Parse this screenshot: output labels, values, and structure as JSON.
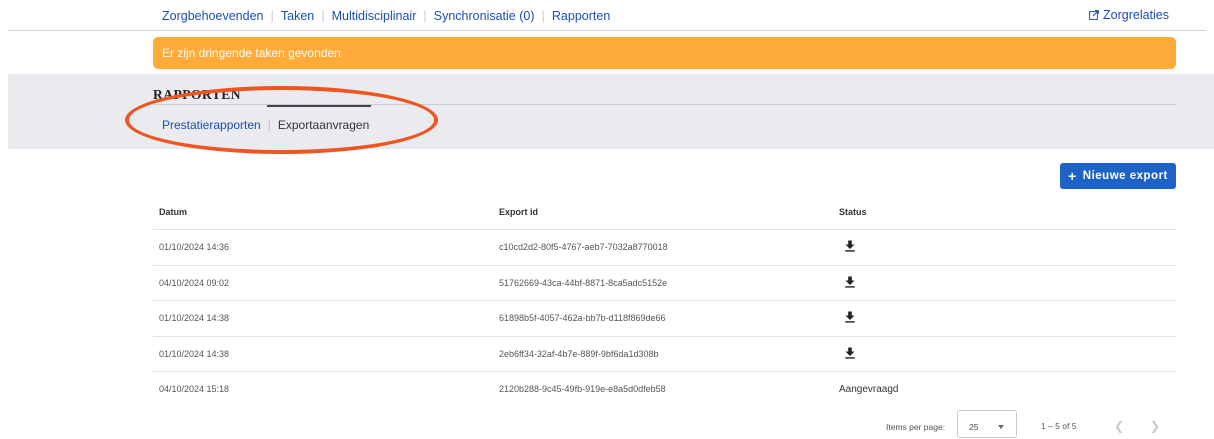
{
  "topnav": {
    "items": [
      {
        "label": "Zorgbehoevenden"
      },
      {
        "label": "Taken"
      },
      {
        "label": "Multidisciplinair"
      },
      {
        "label": "Synchronisatie (0)"
      },
      {
        "label": "Rapporten"
      }
    ],
    "right_link": "Zorgrelaties"
  },
  "alert": {
    "text": "Er zijn dringende taken gevonden",
    "color": "#ffab3a"
  },
  "section": {
    "title": "RAPPORTEN",
    "tabs": [
      {
        "label": "Prestatierapporten",
        "active": false
      },
      {
        "label": "Exportaanvragen",
        "active": true
      }
    ]
  },
  "new_export_button": {
    "label": "Nieuwe export",
    "icon": "plus-icon",
    "color": "#1f62c7"
  },
  "table": {
    "columns": [
      "Datum",
      "Export id",
      "Status"
    ],
    "rows": [
      {
        "datum": "01/10/2024 14:36",
        "export_id": "c10cd2d2-80f5-4767-aeb7-7032a8770018",
        "status": "download-icon"
      },
      {
        "datum": "04/10/2024 09:02",
        "export_id": "51762669-43ca-44bf-8871-8ca5adc5152e",
        "status": "download-icon"
      },
      {
        "datum": "01/10/2024 14:38",
        "export_id": "61898b5f-4057-462a-bb7b-d118f869de66",
        "status": "download-icon"
      },
      {
        "datum": "01/10/2024 14:38",
        "export_id": "2eb6ff34-32af-4b7e-889f-9bf6da1d308b",
        "status": "download-icon"
      },
      {
        "datum": "04/10/2024 15:18",
        "export_id": "2120b288-9c45-49fb-919e-e8a5d0dfeb58",
        "status_text": "Aangevraagd"
      }
    ]
  },
  "pagination": {
    "items_per_page_label": "Items per page:",
    "items_per_page": "25",
    "range": "1 – 5 of 5",
    "prev_icon": "chevron-left-icon",
    "next_icon": "chevron-right-icon"
  },
  "annotation": {
    "color": "#ee5521",
    "shape": "oval-highlight"
  }
}
